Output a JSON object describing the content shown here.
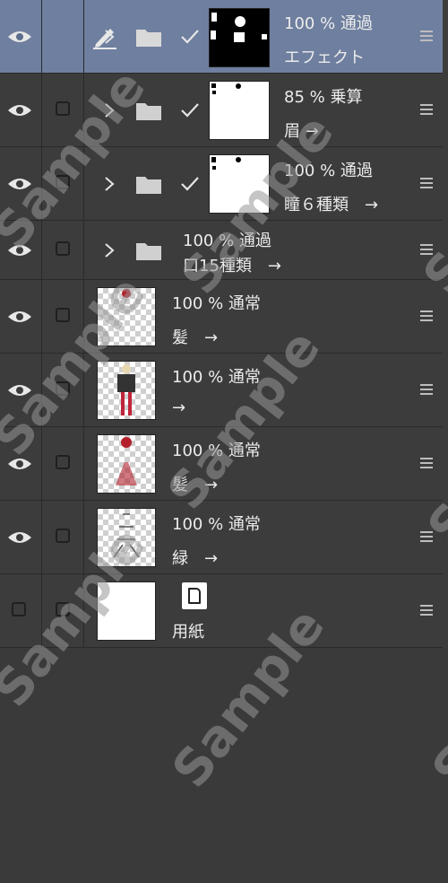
{
  "layers": [
    {
      "opacity_blend": "100 % 通過",
      "name": "エフェクト",
      "selected": true,
      "kind": "folder",
      "thumb": "black"
    },
    {
      "opacity_blend": "85 % 乗算",
      "name": "眉 →",
      "selected": false,
      "kind": "folder",
      "thumb": "white"
    },
    {
      "opacity_blend": "100 % 通過",
      "name": "瞳６種類　→",
      "selected": false,
      "kind": "folder",
      "thumb": "white"
    },
    {
      "opacity_blend": "100 % 通過",
      "name": "口15種類　→",
      "selected": false,
      "kind": "folder-no-thumb"
    },
    {
      "opacity_blend": "100 % 通常",
      "name": "髪　→",
      "selected": false,
      "kind": "raster",
      "thumb": "checker"
    },
    {
      "opacity_blend": "100 % 通常",
      "name": "→",
      "selected": false,
      "kind": "raster",
      "thumb": "checker"
    },
    {
      "opacity_blend": "100 % 通常",
      "name": "髪　→",
      "selected": false,
      "kind": "raster",
      "thumb": "checker"
    },
    {
      "opacity_blend": "100 % 通常",
      "name": "緑　→",
      "selected": false,
      "kind": "raster",
      "thumb": "checker"
    },
    {
      "opacity_blend": "",
      "name": "用紙",
      "selected": false,
      "kind": "paper",
      "thumb": "white"
    }
  ],
  "watermark_text": "Sample",
  "colors": {
    "background": "#3c3c3c",
    "selected_row": "#6f7f9f",
    "separator": "#2a2a2a"
  }
}
